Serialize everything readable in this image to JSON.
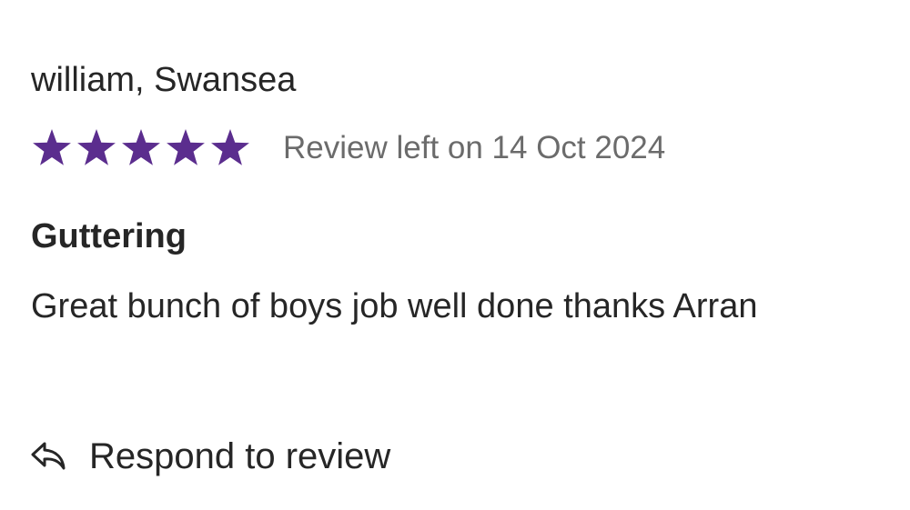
{
  "review": {
    "reviewer": "william, Swansea",
    "rating": 5,
    "rating_max": 5,
    "date_text": "Review left on 14 Oct 2024",
    "title": "Guttering",
    "body": "Great bunch of boys job well done thanks Arran",
    "star_color": "#5b2d8e",
    "star_icon": "star-icon"
  },
  "actions": {
    "respond_label": "Respond to review",
    "respond_icon": "reply-arrow-icon"
  }
}
